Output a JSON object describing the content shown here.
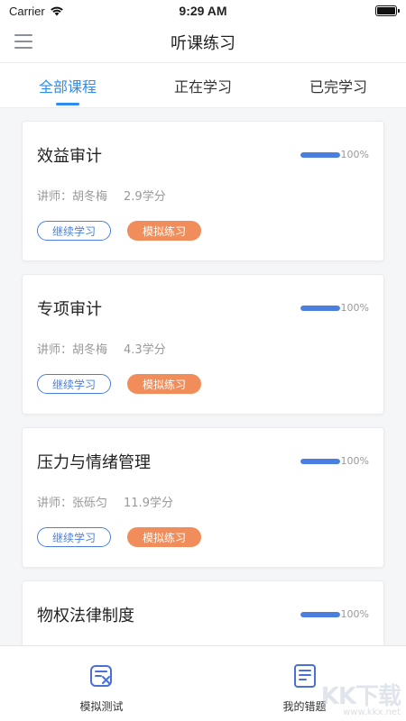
{
  "status_bar": {
    "carrier": "Carrier",
    "time": "9:29 AM"
  },
  "nav": {
    "title": "听课练习"
  },
  "tabs": [
    {
      "label": "全部课程",
      "active": true
    },
    {
      "label": "正在学习",
      "active": false
    },
    {
      "label": "已完学习",
      "active": false
    }
  ],
  "courses": [
    {
      "title": "效益审计",
      "progress_text": "100%",
      "progress": 1.0,
      "teacher": "讲师：胡冬梅",
      "credits": "2.9学分",
      "continue_label": "继续学习",
      "practice_label": "模拟练习"
    },
    {
      "title": "专项审计",
      "progress_text": "100%",
      "progress": 1.0,
      "teacher": "讲师：胡冬梅",
      "credits": "4.3学分",
      "continue_label": "继续学习",
      "practice_label": "模拟练习"
    },
    {
      "title": "压力与情绪管理",
      "progress_text": "100%",
      "progress": 1.0,
      "teacher": "讲师：张砾匀",
      "credits": "11.9学分",
      "continue_label": "继续学习",
      "practice_label": "模拟练习"
    },
    {
      "title": "物权法律制度",
      "progress_text": "100%",
      "progress": 1.0,
      "teacher": "",
      "credits": "",
      "continue_label": "",
      "practice_label": ""
    }
  ],
  "bottom_bar": [
    {
      "label": "模拟测试",
      "icon": "mock-test-icon"
    },
    {
      "label": "我的错题",
      "icon": "wrong-questions-icon"
    }
  ],
  "watermark": {
    "logo": "KK下载",
    "url": "www.kkx.net"
  },
  "colors": {
    "accent": "#2d8cf0",
    "progress": "#4a7fe0",
    "practice": "#f08d5a"
  }
}
